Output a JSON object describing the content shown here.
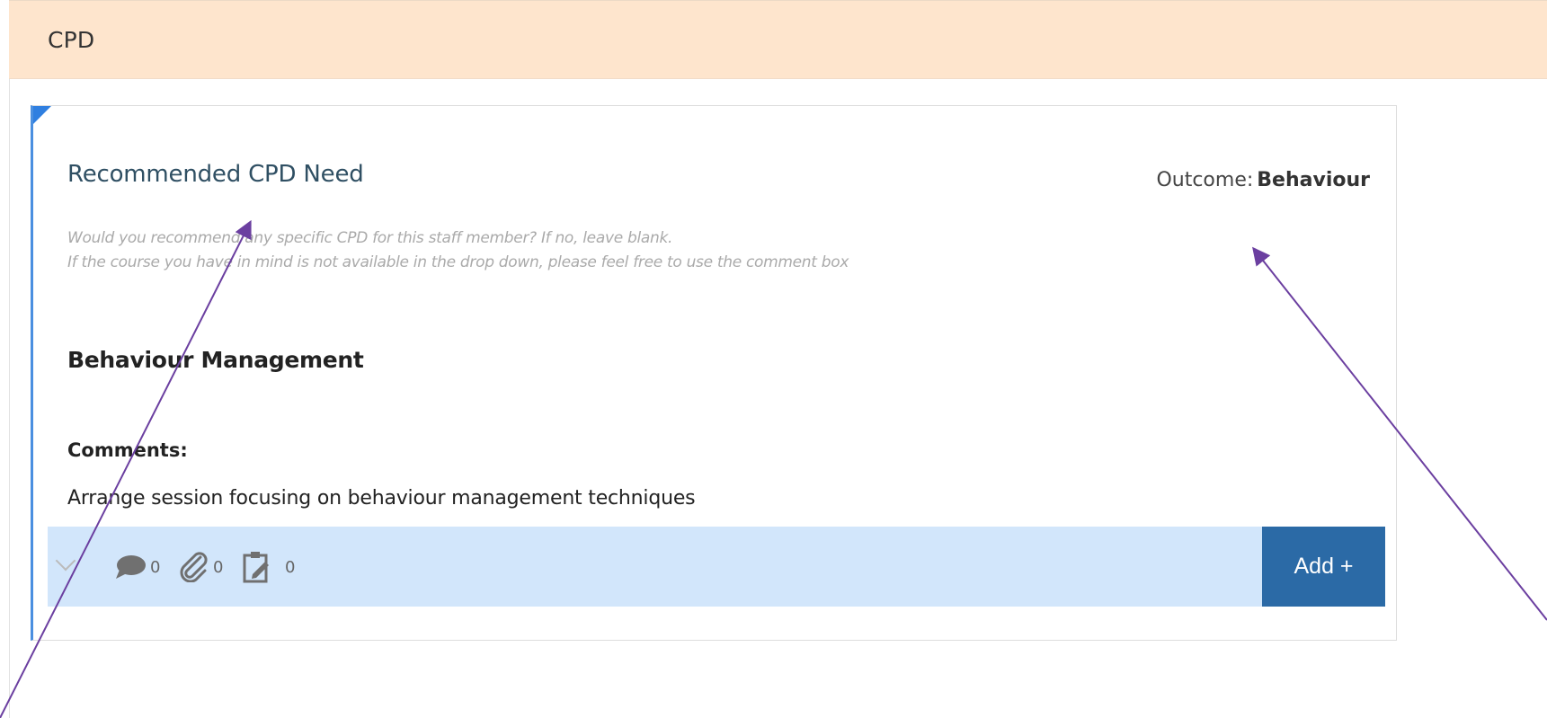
{
  "panel": {
    "title": "CPD"
  },
  "card": {
    "title": "Recommended CPD Need",
    "outcome_label": "Outcome:",
    "outcome_value": "Behaviour",
    "hint_lines": [
      "Would you recommend any specific CPD for this staff member? If no, leave blank.",
      "If the course you have in mind is not available in the drop down, please feel free to use the comment box"
    ],
    "selected_cpd": "Behaviour Management",
    "comments_label": "Comments:",
    "comments_text": "Arrange session focusing on behaviour management techniques"
  },
  "footer": {
    "comments_count": "0",
    "attachments_count": "0",
    "notes_count": "0",
    "add_label": "Add +"
  },
  "icons": {
    "comments": "speech-bubble-icon",
    "attachments": "paperclip-icon",
    "notes": "clipboard-edit-icon",
    "expand": "chevron-down-icon"
  },
  "colors": {
    "header_bg": "#fee5cd",
    "card_accent": "#4a8fe0",
    "footer_bg": "#d2e6fb",
    "add_button_bg": "#2b6aa6",
    "annotation_arrow": "#6b3fa0"
  }
}
